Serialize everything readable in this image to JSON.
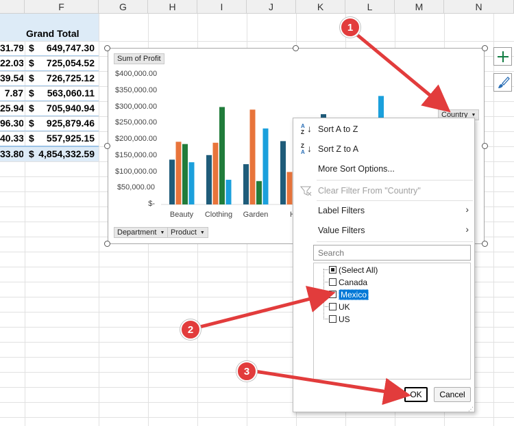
{
  "columns": [
    "F",
    "G",
    "H",
    "I",
    "J",
    "K",
    "L",
    "M",
    "N"
  ],
  "table": {
    "header": "Grand Total",
    "currency": "$",
    "rows": [
      {
        "partial": "31.79",
        "value": "649,747.30"
      },
      {
        "partial": "22.03",
        "value": "725,054.52"
      },
      {
        "partial": "39.54",
        "value": "726,725.12"
      },
      {
        "partial": "7.87",
        "value": "563,060.11"
      },
      {
        "partial": "25.94",
        "value": "705,940.94"
      },
      {
        "partial": "96.30",
        "value": "925,879.46"
      },
      {
        "partial": "40.33",
        "value": "557,925.15"
      }
    ],
    "total": {
      "partial": "33.80",
      "value": "4,854,332.59"
    }
  },
  "chart": {
    "value_button": "Sum of Profit",
    "country_button": "Country",
    "department_button": "Department",
    "product_button": "Product"
  },
  "chart_data": {
    "type": "bar",
    "categories": [
      "Beauty",
      "Clothing",
      "Garden",
      "H"
    ],
    "ylim": [
      0,
      400000
    ],
    "yticks": [
      "$400,000.00",
      "$350,000.00",
      "$300,000.00",
      "$250,000.00",
      "$200,000.00",
      "$150,000.00",
      "$100,000.00",
      "$50,000.00",
      "$-"
    ],
    "series_colors": [
      "#1f5c7a",
      "#e8743b",
      "#217c3b",
      "#1ba0dc"
    ],
    "series": [
      {
        "values": [
          138000,
          152000,
          124000,
          195000
        ]
      },
      {
        "values": [
          193000,
          190000,
          292000,
          100000
        ]
      },
      {
        "values": [
          186000,
          300000,
          72000,
          null
        ]
      },
      {
        "values": [
          130000,
          76000,
          234000,
          null
        ]
      }
    ],
    "partial_bars": [
      {
        "category_index": 4,
        "series": 0,
        "value": 278000
      },
      {
        "category_index": 5,
        "series": 3,
        "value": 334000
      }
    ]
  },
  "menu": {
    "sort_az": "Sort A to Z",
    "sort_za": "Sort Z to A",
    "more_sort": "More Sort Options...",
    "clear_filter": "Clear Filter From \"Country\"",
    "label_filters": "Label Filters",
    "value_filters": "Value Filters",
    "search_placeholder": "Search",
    "items": [
      {
        "label": "(Select All)",
        "state": "indeterminate"
      },
      {
        "label": "Canada",
        "state": "unchecked"
      },
      {
        "label": "Mexico",
        "state": "checked"
      },
      {
        "label": "UK",
        "state": "unchecked"
      },
      {
        "label": "US",
        "state": "unchecked"
      }
    ],
    "ok": "OK",
    "cancel": "Cancel"
  },
  "annotations": {
    "step1": "1",
    "step2": "2",
    "step3": "3",
    "color": "#e23c3c"
  }
}
